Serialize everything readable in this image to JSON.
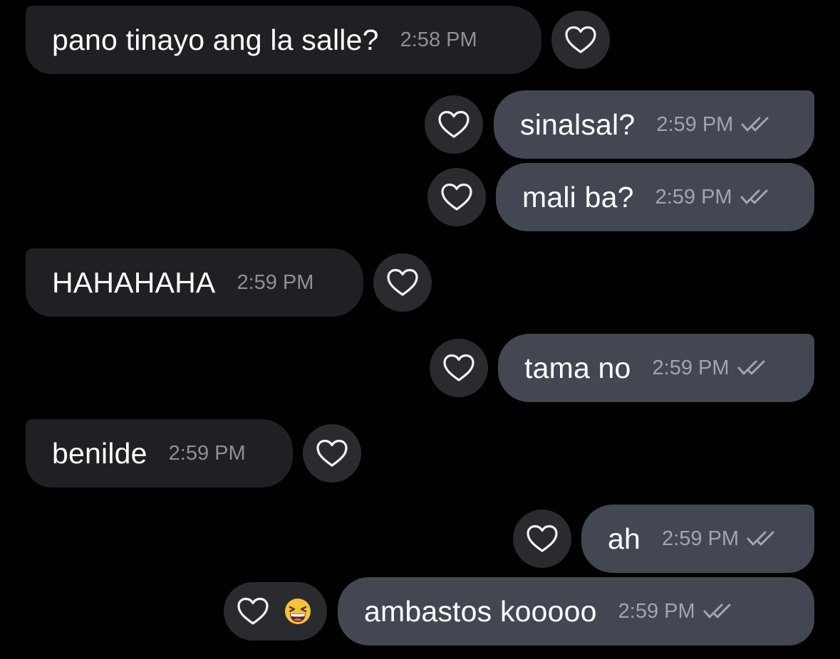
{
  "messages": [
    {
      "direction": "incoming",
      "text": "pano tinayo ang la salle?",
      "time": "2:58 PM"
    },
    {
      "direction": "outgoing",
      "text": "sinalsal?",
      "time": "2:59 PM",
      "read": true
    },
    {
      "direction": "outgoing",
      "text": "mali ba?",
      "time": "2:59 PM",
      "read": true
    },
    {
      "direction": "incoming",
      "text": "HAHAHAHA",
      "time": "2:59 PM"
    },
    {
      "direction": "outgoing",
      "text": "tama no",
      "time": "2:59 PM",
      "read": true
    },
    {
      "direction": "incoming",
      "text": "benilde",
      "time": "2:59 PM"
    },
    {
      "direction": "outgoing",
      "text": "ah",
      "time": "2:59 PM",
      "read": true
    },
    {
      "direction": "outgoing",
      "text": "ambastos kooooo",
      "time": "2:59 PM",
      "read": true,
      "reaction": "grinning-squinting-face-emoji"
    }
  ],
  "icons": {
    "like": "heart-outline-icon",
    "read_receipt": "double-check-icon"
  },
  "colors": {
    "background": "#000000",
    "incoming_bubble": "#1f2024",
    "outgoing_bubble": "#434752",
    "reaction_button": "#2a2b2f",
    "text": "#ffffff",
    "timestamp": "#8d9099"
  }
}
